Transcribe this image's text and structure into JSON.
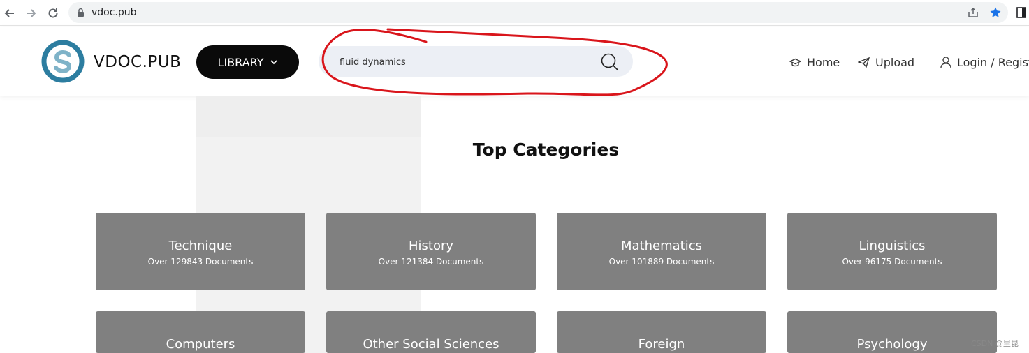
{
  "browser": {
    "url": "vdoc.pub"
  },
  "site": {
    "brand": "VDOC.PUB",
    "library_label": "LIBRARY",
    "search": {
      "value": "fluid dynamics",
      "placeholder": ""
    },
    "nav": [
      {
        "label": "Home",
        "icon": "graduation-cap-icon"
      },
      {
        "label": "Upload",
        "icon": "paper-plane-icon"
      },
      {
        "label": "Login / Registe",
        "icon": "user-icon"
      }
    ]
  },
  "categories_section": {
    "title": "Top Categories",
    "items": [
      {
        "name": "Technique",
        "count": "Over 129843 Documents"
      },
      {
        "name": "History",
        "count": "Over 121384 Documents"
      },
      {
        "name": "Mathematics",
        "count": "Over 101889 Documents"
      },
      {
        "name": "Linguistics",
        "count": "Over 96175 Documents"
      },
      {
        "name": "Computers",
        "count": ""
      },
      {
        "name": "Other Social Sciences",
        "count": ""
      },
      {
        "name": "Foreign",
        "count": ""
      },
      {
        "name": "Psychology",
        "count": ""
      }
    ]
  },
  "watermark": "CSDN @里昆",
  "colors": {
    "card_bg": "#808080",
    "annotation": "#d9151b",
    "library_btn": "#0a0a0a",
    "search_bg": "#eceff5",
    "star": "#1a73e8"
  }
}
